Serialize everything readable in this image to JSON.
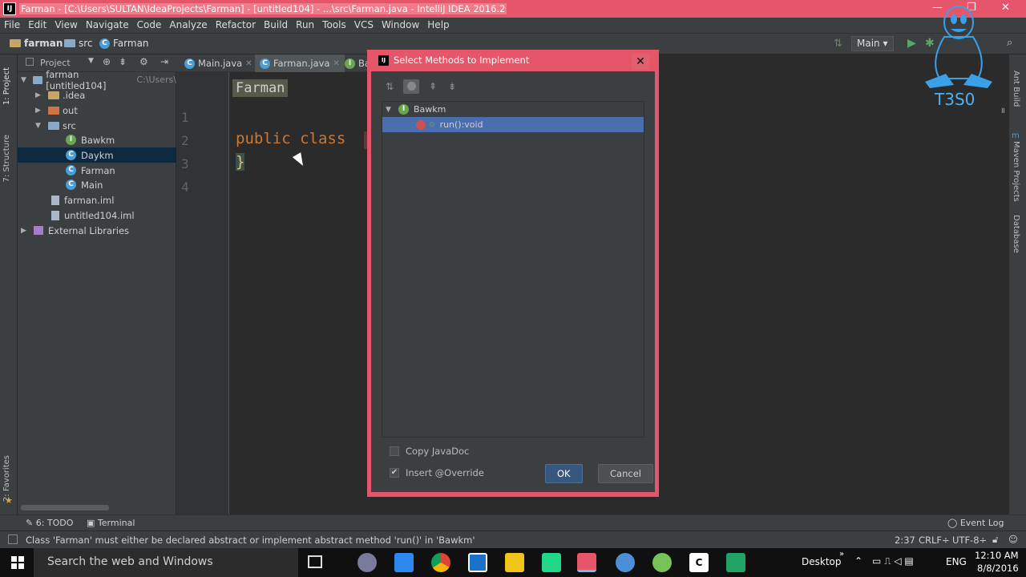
{
  "window": {
    "title": "Farman - [C:\\Users\\SULTAN\\IdeaProjects\\Farman] - [untitled104] - ...\\src\\Farman.java - IntelliJ IDEA 2016.2",
    "app_icon": "IJ"
  },
  "menu": [
    "File",
    "Edit",
    "View",
    "Navigate",
    "Code",
    "Analyze",
    "Refactor",
    "Build",
    "Run",
    "Tools",
    "VCS",
    "Window",
    "Help"
  ],
  "nav": {
    "crumbs": [
      "farman",
      "src",
      "Farman"
    ],
    "run_config": "Main"
  },
  "left_strip": {
    "project": "1: Project",
    "structure": "7: Structure",
    "favorites": "2: Favorites"
  },
  "right_strip": {
    "ant": "Ant Build",
    "maven": "Maven Projects",
    "database": "Database"
  },
  "project_panel": {
    "header": "Project",
    "tree": [
      {
        "label": "farman [untitled104]",
        "suffix": "C:\\Users\\"
      },
      {
        "label": ".idea"
      },
      {
        "label": "out"
      },
      {
        "label": "src"
      },
      {
        "label": "Bawkm"
      },
      {
        "label": "Daykm"
      },
      {
        "label": "Farman"
      },
      {
        "label": "Main"
      },
      {
        "label": "farman.iml"
      },
      {
        "label": "untitled104.iml"
      },
      {
        "label": "External Libraries"
      }
    ]
  },
  "editor": {
    "tabs": [
      "Main.java",
      "Farman.java",
      "Ba"
    ],
    "breadcrumb_tag": "Farman",
    "line_numbers": [
      "1",
      "2",
      "3",
      "4"
    ],
    "code_keyword": "public class",
    "code_brace": "}"
  },
  "dialog": {
    "title": "Select Methods to Implement",
    "close": "✕",
    "tree_parent": "Bawkm",
    "tree_child": "run():void",
    "copy_javadoc": "Copy JavaDoc",
    "insert_override": "Insert @Override",
    "ok": "OK",
    "cancel": "Cancel"
  },
  "bottom_tabs": {
    "todo": "6: TODO",
    "terminal": "Terminal",
    "event_log": "Event Log"
  },
  "status": {
    "message": "Class 'Farman' must either be declared abstract or implement abstract method 'run()' in 'Bawkm'",
    "position": "2:37",
    "line_sep": "CRLF÷",
    "encoding": "UTF-8÷"
  },
  "taskbar": {
    "search_placeholder": "Search the web and Windows",
    "desktop": "Desktop",
    "lang": "ENG",
    "time": "12:10 AM",
    "date": "8/8/2016"
  },
  "watermark": {
    "text": "T3S0"
  },
  "colors": {
    "title_bar": "#e5566b",
    "selection": "#4b6eaf",
    "keyword": "#cc7832"
  }
}
